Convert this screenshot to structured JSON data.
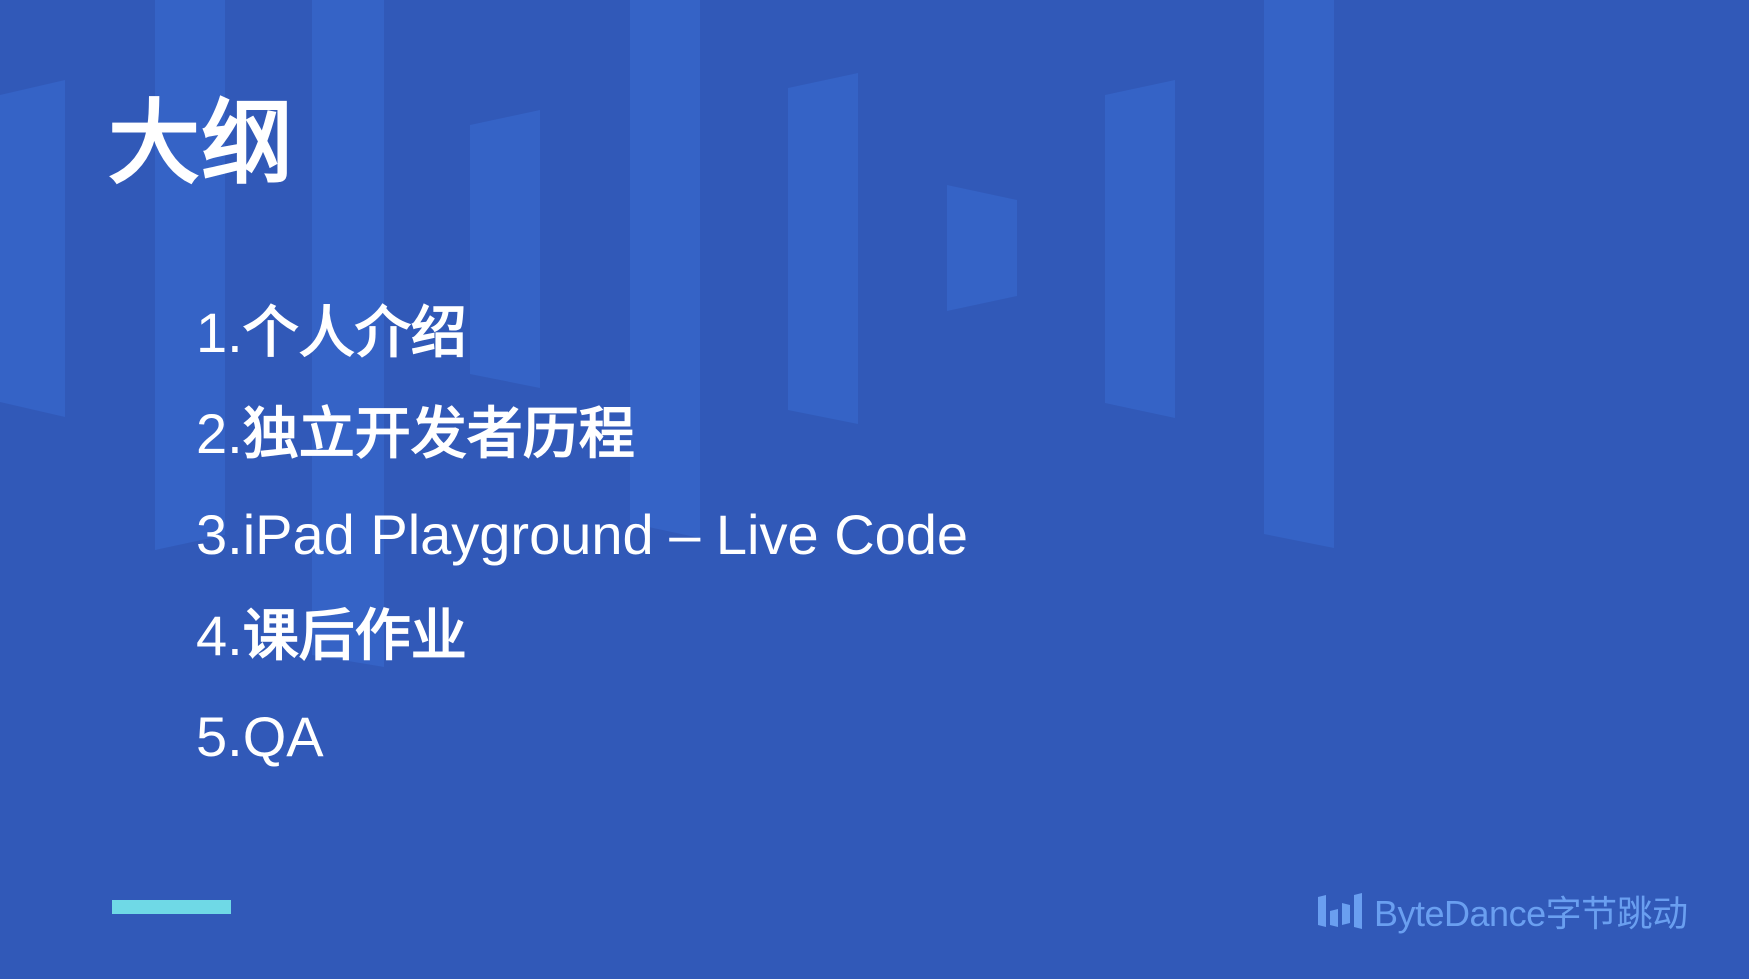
{
  "slide": {
    "title": "大纲",
    "outline": [
      {
        "num": "1.",
        "text": "个人介绍"
      },
      {
        "num": "2.",
        "text": "独立开发者历程"
      },
      {
        "num": "3.",
        "text": "iPad Playground – Live Code"
      },
      {
        "num": "4.",
        "text": "课后作业"
      },
      {
        "num": "5.",
        "text": "QA"
      }
    ],
    "brand": {
      "name": "ByteDance字节跳动",
      "icon": "bytedance-logo-icon"
    }
  },
  "colors": {
    "background": "#3159b8",
    "decor": "#3563c6",
    "text": "#ffffff",
    "accent_bar": "#6fd9e6",
    "brand": "#6a9ff0"
  }
}
